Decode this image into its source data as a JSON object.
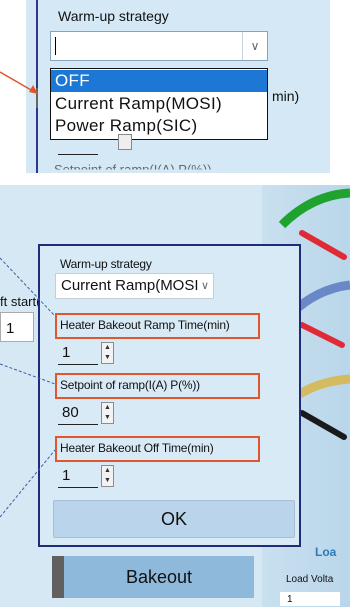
{
  "top": {
    "title": "Warm-up strategy",
    "combo_value": "",
    "options": [
      "OFF",
      "Current Ramp(MOSI)",
      "Power Ramp(SIC)"
    ],
    "selected_index": 0,
    "side_text": "min)",
    "faded_text": "Setpoint of ramp(I(A) P(%))"
  },
  "left_fragment": {
    "label": "ft start(",
    "value": "1"
  },
  "dialog": {
    "strategy_label": "Warm-up strategy",
    "strategy_value": "Current Ramp(MOSI",
    "ramp_time_label": "Heater Bakeout Ramp Time(min)",
    "ramp_time_value": "1",
    "setpoint_label": "Setpoint of ramp(I(A) P(%))",
    "setpoint_value": "80",
    "off_time_label": "Heater Bakeout Off Time(min)",
    "off_time_value": "1",
    "ok_label": "OK"
  },
  "bottom": {
    "bakeout_label": "Bakeout",
    "lo_label": "Loa",
    "load_voltage_label": "Load Volta",
    "load_value": "1"
  },
  "colors": {
    "highlight_border": "#e0562d",
    "selected_option": "#1c78d4",
    "dialog_border": "#1e2c7a",
    "panel_bg": "#d4e8f6"
  }
}
